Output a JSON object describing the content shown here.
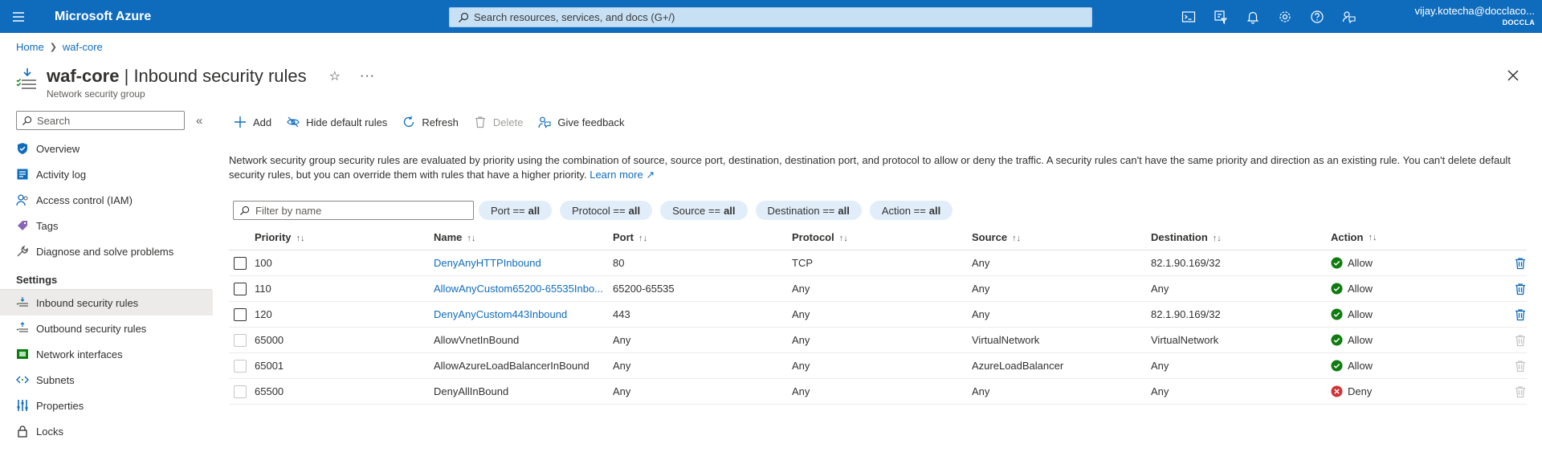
{
  "topbar": {
    "brand": "Microsoft Azure",
    "search_placeholder": "Search resources, services, and docs (G+/)",
    "icons": [
      "cloud-shell-icon",
      "directory-filter-icon",
      "notifications-icon",
      "settings-icon",
      "help-icon",
      "feedback-icon"
    ],
    "account_name": "vijay.kotecha@docclaco...",
    "account_tenant": "DOCCLA",
    "bg_color": "#0f6cbd"
  },
  "breadcrumb": {
    "home": "Home",
    "resource": "waf-core"
  },
  "header": {
    "resource_name": "waf-core",
    "separator": " | ",
    "page": "Inbound security rules",
    "subtitle": "Network security group",
    "more": "···"
  },
  "sidebar": {
    "search_placeholder": "Search",
    "items_top": [
      {
        "label": "Overview",
        "icon": "overview-shield-icon"
      },
      {
        "label": "Activity log",
        "icon": "activity-log-icon"
      },
      {
        "label": "Access control (IAM)",
        "icon": "iam-people-icon"
      },
      {
        "label": "Tags",
        "icon": "tag-icon"
      },
      {
        "label": "Diagnose and solve problems",
        "icon": "wrench-icon"
      }
    ],
    "section_settings": "Settings",
    "items_settings": [
      {
        "label": "Inbound security rules",
        "icon": "inbound-rules-icon",
        "active": true
      },
      {
        "label": "Outbound security rules",
        "icon": "outbound-rules-icon",
        "active": false
      },
      {
        "label": "Network interfaces",
        "icon": "nic-icon",
        "active": false
      },
      {
        "label": "Subnets",
        "icon": "subnet-icon",
        "active": false
      },
      {
        "label": "Properties",
        "icon": "properties-icon",
        "active": false
      },
      {
        "label": "Locks",
        "icon": "lock-icon",
        "active": false
      }
    ]
  },
  "toolbar": {
    "add": "Add",
    "hide_default": "Hide default rules",
    "refresh": "Refresh",
    "delete": "Delete",
    "feedback": "Give feedback"
  },
  "description": {
    "text": "Network security group security rules are evaluated by priority using the combination of source, source port, destination, destination port, and protocol to allow or deny the traffic. A security rules can't have the same priority and direction as an existing rule. You can't delete default security rules, but you can override them with rules that have a higher priority.",
    "learn_more": "Learn more"
  },
  "filters": {
    "placeholder": "Filter by name",
    "pills": [
      {
        "label": "Port ==",
        "value": "all"
      },
      {
        "label": "Protocol ==",
        "value": "all"
      },
      {
        "label": "Source ==",
        "value": "all"
      },
      {
        "label": "Destination ==",
        "value": "all"
      },
      {
        "label": "Action ==",
        "value": "all"
      }
    ]
  },
  "table": {
    "columns": [
      "Priority",
      "Name",
      "Port",
      "Protocol",
      "Source",
      "Destination",
      "Action"
    ],
    "rows": [
      {
        "priority": "100",
        "name": "DenyAnyHTTPInbound",
        "port": "80",
        "protocol": "TCP",
        "source": "Any",
        "destination": "82.1.90.169/32",
        "action": "Allow",
        "custom": true
      },
      {
        "priority": "110",
        "name": "AllowAnyCustom65200-65535Inbo...",
        "port": "65200-65535",
        "protocol": "Any",
        "source": "Any",
        "destination": "Any",
        "action": "Allow",
        "custom": true
      },
      {
        "priority": "120",
        "name": "DenyAnyCustom443Inbound",
        "port": "443",
        "protocol": "Any",
        "source": "Any",
        "destination": "82.1.90.169/32",
        "action": "Allow",
        "custom": true
      },
      {
        "priority": "65000",
        "name": "AllowVnetInBound",
        "port": "Any",
        "protocol": "Any",
        "source": "VirtualNetwork",
        "destination": "VirtualNetwork",
        "action": "Allow",
        "custom": false
      },
      {
        "priority": "65001",
        "name": "AllowAzureLoadBalancerInBound",
        "port": "Any",
        "protocol": "Any",
        "source": "AzureLoadBalancer",
        "destination": "Any",
        "action": "Allow",
        "custom": false
      },
      {
        "priority": "65500",
        "name": "DenyAllInBound",
        "port": "Any",
        "protocol": "Any",
        "source": "Any",
        "destination": "Any",
        "action": "Deny",
        "custom": false
      }
    ],
    "allow_color": "#107c10",
    "deny_color": "#d13438"
  }
}
